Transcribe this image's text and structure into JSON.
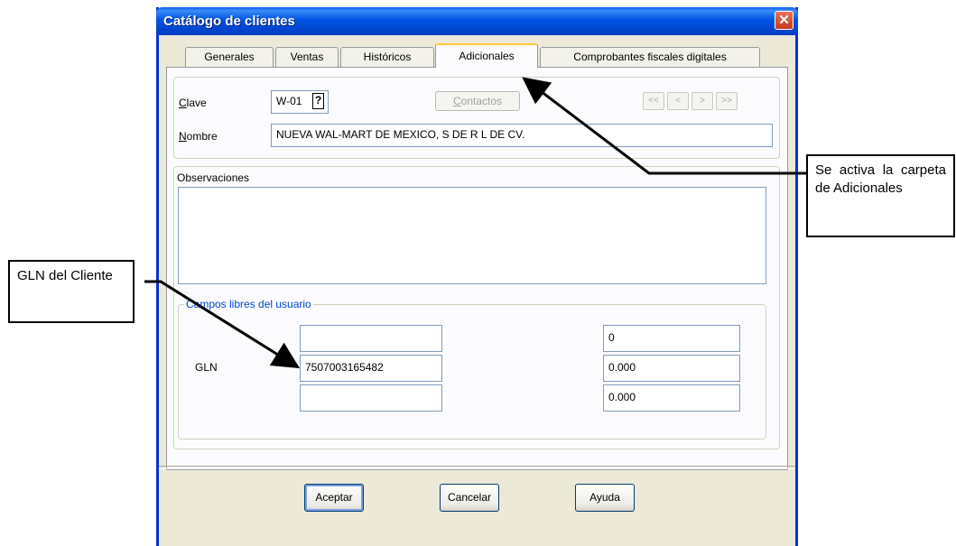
{
  "window": {
    "title": "Catálogo de clientes",
    "close_glyph": "✕"
  },
  "tabs": [
    {
      "label": "Generales"
    },
    {
      "label": "Ventas"
    },
    {
      "label": "Históricos"
    },
    {
      "label": "Adicionales"
    },
    {
      "label": "Comprobantes fiscales digitales"
    }
  ],
  "header": {
    "clave_label_first": "C",
    "clave_label_rest": "lave",
    "clave_value": "W-01",
    "help_glyph": "?",
    "contactos_first": "C",
    "contactos_rest": "ontactos",
    "nav": [
      "<<",
      "<",
      ">",
      ">>"
    ],
    "nombre_label_first": "N",
    "nombre_label_rest": "ombre",
    "nombre_value": "NUEVA WAL-MART DE MEXICO, S DE R L DE CV."
  },
  "observaciones": {
    "label": "Observaciones",
    "value": ""
  },
  "campos": {
    "legend": "Campos libres del usuario",
    "gln_label": "GLN",
    "text_fields": [
      "",
      "7507003165482",
      ""
    ],
    "numeric_fields": [
      "0",
      "0.000",
      "0.000"
    ]
  },
  "buttons": {
    "aceptar": "Aceptar",
    "cancelar": "Cancelar",
    "ayuda": "Ayuda"
  },
  "annotations": {
    "right_callout": "Se activa la carpeta de Adicionales",
    "left_callout": "GLN del Cliente"
  },
  "colors": {
    "titlebar": "#0054e3",
    "window_bg": "#ece9d8",
    "legend_text": "#0046d5",
    "active_tab_accent": "#ffc83c"
  }
}
